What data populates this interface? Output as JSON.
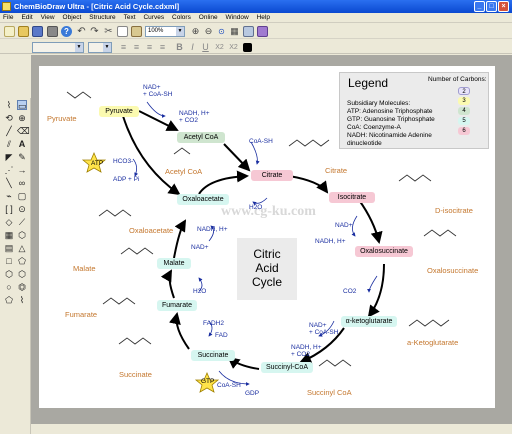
{
  "window": {
    "title": "ChemBioDraw Ultra - [Citric Acid Cycle.cdxml]"
  },
  "menu": [
    "File",
    "Edit",
    "View",
    "Object",
    "Structure",
    "Text",
    "Curves",
    "Colors",
    "Online",
    "Window",
    "Help"
  ],
  "toolbar": {
    "zoom": "100%",
    "text_style_icons": [
      "B",
      "I",
      "U",
      "X2",
      "X2"
    ]
  },
  "colors": {
    "yellow": "#fbfab0",
    "pink": "#f6c8d4",
    "cyan": "#d6f6f0",
    "green": "#cfe5cf",
    "coenzyme_text": "#1a2ea0",
    "molecule_text": "#c4772e"
  },
  "cycle": {
    "center_label": [
      "Citric",
      "Acid",
      "Cycle"
    ],
    "nodes": {
      "pyruvate": "Pyruvate",
      "acetyl_coa": "Acetyl CoA",
      "citrate": "Citrate",
      "isocitrate": "Isocitrate",
      "oxalosuccinate": "Oxalosuccinate",
      "a_ketoglutarate": "α-ketoglutarate",
      "succinyl_coa": "Succinyl-CoA",
      "succinate": "Succinate",
      "fumarate": "Fumarate",
      "malate": "Malate",
      "oxaloacetate": "Oxaloacetate"
    },
    "molecule_labels": {
      "pyruvate": "Pyruvate",
      "acetyl_coa": "Acetyl CoA",
      "citrate": "Citrate",
      "d_isocitrate": "D-isocitrate",
      "oxalosuccinate": "Oxalosuccinate",
      "a_ketoglutarate": "a-Ketoglutarate",
      "succinyl_coa": "Succinyl CoA",
      "succinate": "Succinate",
      "fumarate": "Fumarate",
      "malate": "Malate",
      "oxaloacetate": "Oxaloacetate"
    },
    "coenzymes": {
      "pyr_in_1": "NAD+",
      "pyr_in_2": "+ CoA-SH",
      "pyr_out_1": "NADH, H+",
      "pyr_out_2": "+ CO2",
      "hco3": "HCO3-",
      "atp": "ATP",
      "adp": "ADP + Pi",
      "coa_sh_top": "CoA-SH",
      "h2o_top": "H2O",
      "iso_nad": "NAD+",
      "iso_nadh": "NADH, H+",
      "co2_ox": "CO2",
      "akg_in1": "NAD+",
      "akg_in2": "+ CoA-SH",
      "akg_out1": "NADH, H+",
      "akg_out2": "+ CO2",
      "gtp": "GTP",
      "gdp": "GDP",
      "coa_sh_bottom": "CoA-SH",
      "fadh2": "FADH2",
      "fad": "FAD",
      "h2o_mid": "H2O",
      "mal_nad": "NAD+",
      "mal_nadh": "NADH, H+"
    }
  },
  "legend": {
    "title": "Legend",
    "carbons_header": "Number of Carbons:",
    "carbons": [
      "2",
      "3",
      "4",
      "5",
      "6"
    ],
    "subsidiary_header": "Subsidiary Molecules:",
    "subsidiary": [
      "ATP: Adenosine Triphosphate",
      "GTP: Guanosine Triphosphate",
      "CoA: Coenzyme-A",
      "NADH: Nicotinamide Adenine",
      "dinucleotide"
    ]
  },
  "watermark": "www.cg-ku.com"
}
